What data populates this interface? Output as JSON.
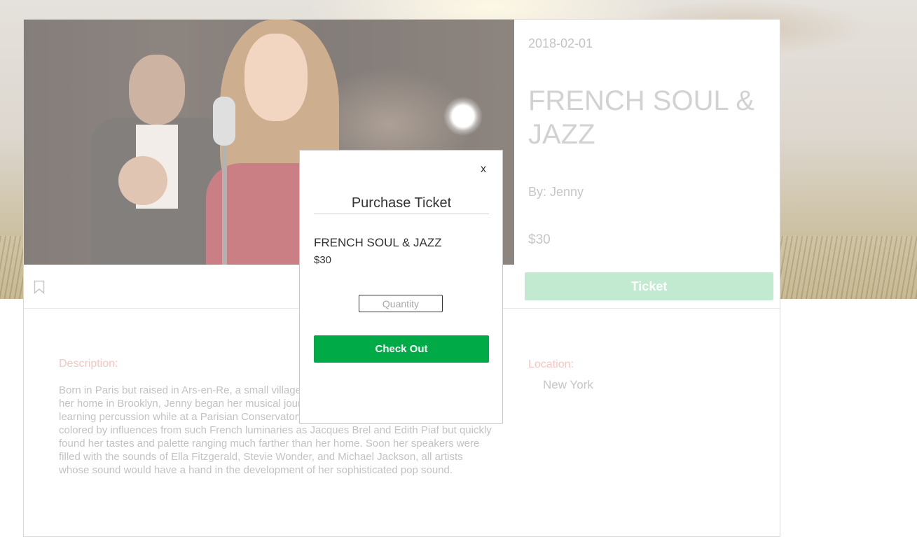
{
  "event": {
    "date": "2018-02-01",
    "title": "FRENCH SOUL & JAZZ",
    "by": "By: Jenny",
    "price": "$30",
    "ticket_label": "Ticket",
    "description_label": "Description:",
    "description": "Born in Paris but raised in Ars-en-Re, a small village on the Atlantic Coast, and now making her home in Brooklyn, Jenny began her musical journey at an early age, taking up and learning percussion while at a Parisian Conservatory. Her musical endeavors were clearly colored by influences from such French luminaries as Jacques Brel and Edith Piaf but quickly found her tastes and palette ranging much farther than her home. Soon her speakers were filled with the sounds of Ella Fitzgerald, Stevie Wonder, and Michael Jackson, all artists whose sound would have a hand in the development of her sophisticated pop sound.",
    "location_label": "Location:",
    "location": "New York"
  },
  "modal": {
    "close_label": "x",
    "title": "Purchase Ticket",
    "event_name": "FRENCH SOUL & JAZZ",
    "price": "$30",
    "quantity_placeholder": "Quantity",
    "checkout_label": "Check Out"
  },
  "icons": {
    "bookmark": "bookmark-icon"
  },
  "colors": {
    "checkout_green": "#00ab47",
    "ticket_green_faded": "#c1ead0",
    "label_pink_faded": "#f5c6c2"
  }
}
